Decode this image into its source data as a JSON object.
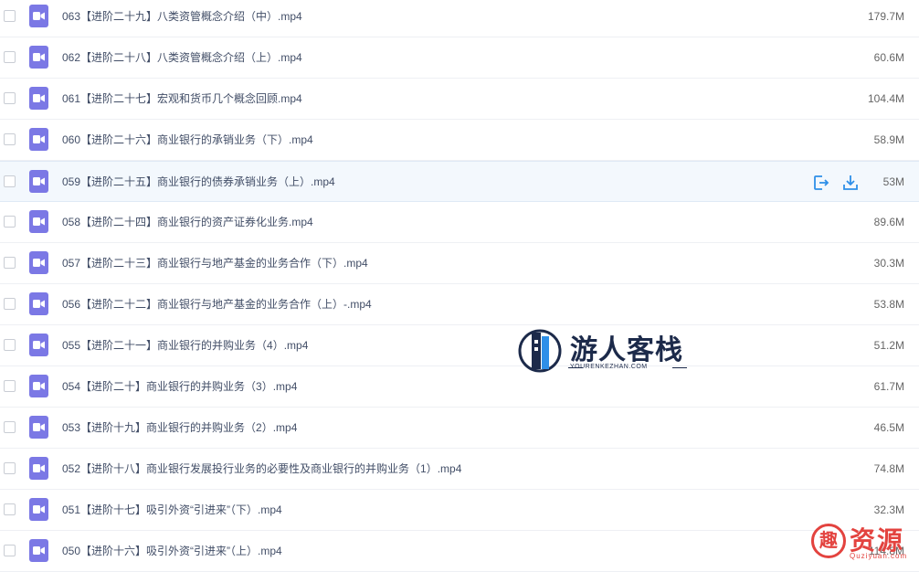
{
  "files": [
    {
      "name": "063【进阶二十九】八类资管概念介绍（中）.mp4",
      "size": "179.7M",
      "icon": "video-file-icon"
    },
    {
      "name": "062【进阶二十八】八类资管概念介绍（上）.mp4",
      "size": "60.6M",
      "icon": "video-file-icon"
    },
    {
      "name": "061【进阶二十七】宏观和货币几个概念回顾.mp4",
      "size": "104.4M",
      "icon": "video-file-icon"
    },
    {
      "name": "060【进阶二十六】商业银行的承销业务（下）.mp4",
      "size": "58.9M",
      "icon": "video-file-icon"
    },
    {
      "name": "059【进阶二十五】商业银行的债券承销业务（上）.mp4",
      "size": "53M",
      "icon": "video-file-icon",
      "hovered": true
    },
    {
      "name": "058【进阶二十四】商业银行的资产证券化业务.mp4",
      "size": "89.6M",
      "icon": "video-file-icon"
    },
    {
      "name": "057【进阶二十三】商业银行与地产基金的业务合作（下）.mp4",
      "size": "30.3M",
      "icon": "video-file-icon"
    },
    {
      "name": "056【进阶二十二】商业银行与地产基金的业务合作（上）-.mp4",
      "size": "53.8M",
      "icon": "video-file-icon"
    },
    {
      "name": "055【进阶二十一】商业银行的并购业务（4）.mp4",
      "size": "51.2M",
      "icon": "video-file-icon"
    },
    {
      "name": "054【进阶二十】商业银行的并购业务（3）.mp4",
      "size": "61.7M",
      "icon": "video-file-icon"
    },
    {
      "name": "053【进阶十九】商业银行的并购业务（2）.mp4",
      "size": "46.5M",
      "icon": "video-file-icon"
    },
    {
      "name": "052【进阶十八】商业银行发展投行业务的必要性及商业银行的并购业务（1）.mp4",
      "size": "74.8M",
      "icon": "video-file-icon"
    },
    {
      "name": "051【进阶十七】吸引外资“引进来”（下）.mp4",
      "size": "32.3M",
      "icon": "video-file-icon"
    },
    {
      "name": "050【进阶十六】吸引外资“引进来”（上）.mp4",
      "size": "114.8M",
      "icon": "video-file-icon"
    }
  ],
  "row_actions": {
    "share_icon": "share-export-icon",
    "download_icon": "download-icon"
  },
  "watermark": {
    "brand": "游人客栈",
    "domain": "YOURENKEZHAN.COM"
  },
  "corner_badge": {
    "glyph": "趣",
    "text": "资源",
    "sub": "Quziyuan.com"
  },
  "colors": {
    "accent": "#2e8fe8",
    "file_icon": "#7b78e5",
    "hover_row": "#f3f8fd",
    "badge": "#e3433f"
  }
}
